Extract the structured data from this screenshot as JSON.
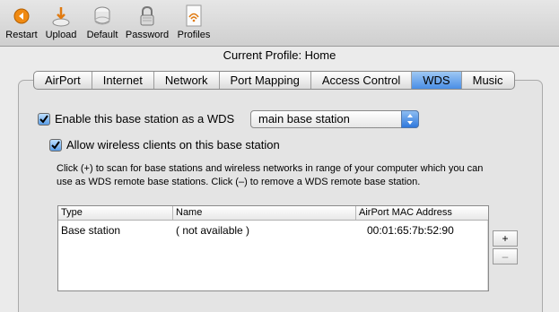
{
  "toolbar": {
    "restart": "Restart",
    "upload": "Upload",
    "default": "Default",
    "password": "Password",
    "profiles": "Profiles"
  },
  "profile_title": "Current Profile: Home",
  "tabs": [
    "AirPort",
    "Internet",
    "Network",
    "Port Mapping",
    "Access Control",
    "WDS",
    "Music"
  ],
  "active_tab": "WDS",
  "wds": {
    "enable_label": "Enable this base station as a WDS",
    "enable_checked": true,
    "mode_value": "main base station",
    "allow_label": "Allow wireless clients on this base station",
    "allow_checked": true,
    "description": "Click (+) to scan for base stations and wireless networks in range of your computer which you can use as WDS remote base stations. Click (–) to remove a WDS remote base station."
  },
  "table": {
    "columns": [
      "Type",
      "Name",
      "AirPort MAC Address"
    ],
    "rows": [
      {
        "type": "Base station",
        "name": "( not available )",
        "mac": "00:01:65:7b:52:90"
      }
    ]
  },
  "buttons": {
    "add": "+",
    "remove": "–"
  },
  "colors": {
    "accent": "#4a8ee6",
    "toolbar_bg": "#d8d8d8",
    "panel_bg": "#e4e4e4"
  }
}
